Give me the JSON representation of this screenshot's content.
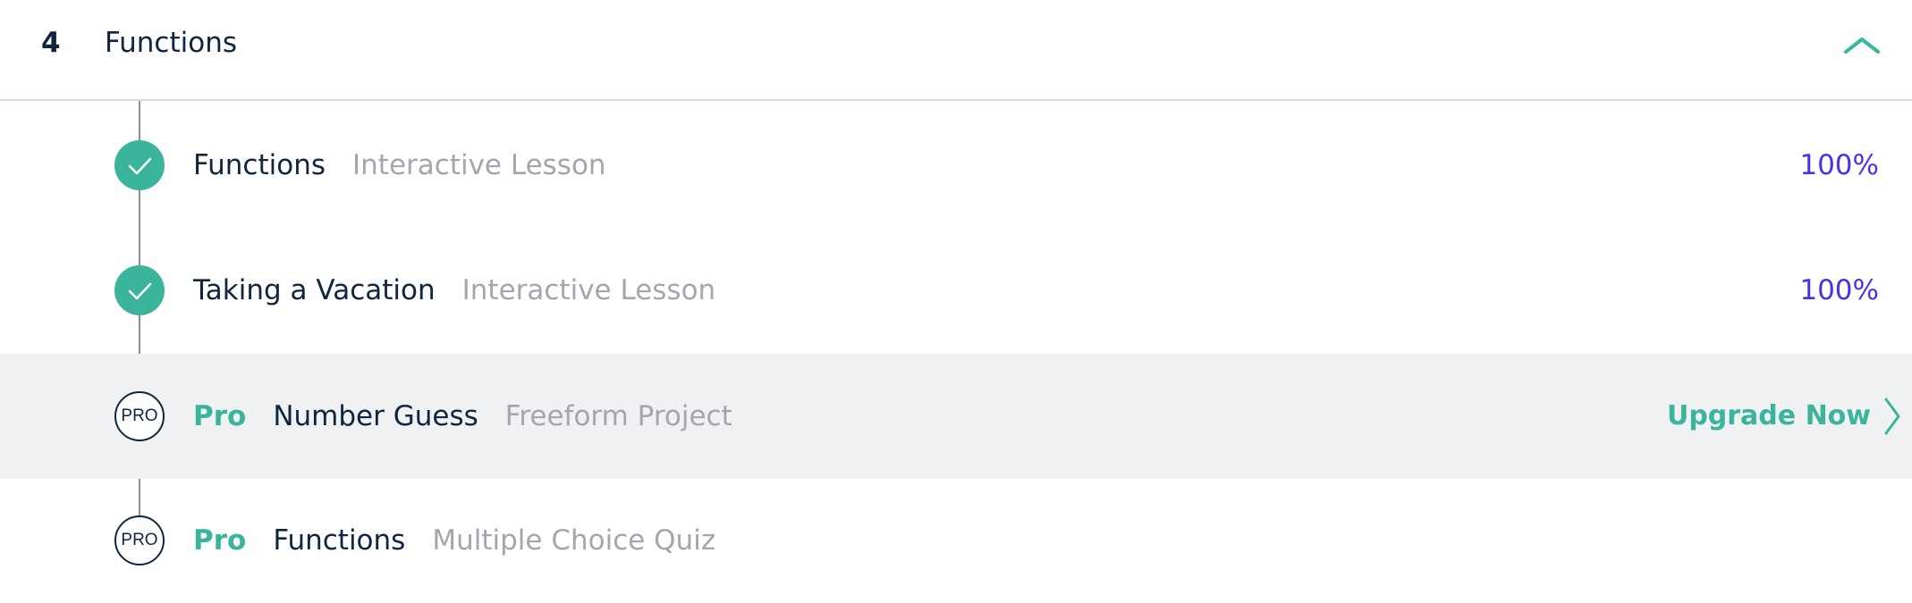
{
  "section": {
    "number": "4",
    "title": "Functions",
    "collapse_icon": "chevron-up-icon"
  },
  "colors": {
    "accent_green": "#3ab59c",
    "percent_purple": "#4f2fe8",
    "title_navy": "#10253f",
    "muted_gray": "#a3a7ad",
    "highlight_row": "#f0f1f2"
  },
  "lessons": [
    {
      "status": "completed",
      "status_icon": "checkmark-icon",
      "title": "Functions",
      "type": "Interactive Lesson",
      "progress": "100%"
    },
    {
      "status": "completed",
      "status_icon": "checkmark-icon",
      "title": "Taking a Vacation",
      "type": "Interactive Lesson",
      "progress": "100%"
    },
    {
      "status": "pro",
      "badge": "PRO",
      "pro_label": "Pro",
      "title": "Number Guess",
      "type": "Freeform Project",
      "cta": "Upgrade Now",
      "cta_icon": "chevron-right-icon",
      "highlighted": true
    },
    {
      "status": "pro",
      "badge": "PRO",
      "pro_label": "Pro",
      "title": "Functions",
      "type": "Multiple Choice Quiz"
    }
  ]
}
